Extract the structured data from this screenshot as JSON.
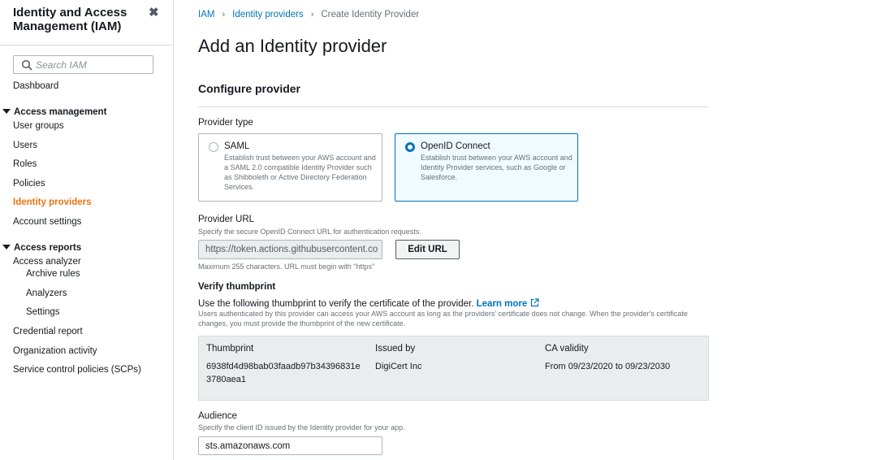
{
  "sidebar": {
    "title": "Identity and Access Management (IAM)",
    "search_placeholder": "Search IAM",
    "dashboard": "Dashboard",
    "access_management": {
      "heading": "Access management",
      "items": [
        "User groups",
        "Users",
        "Roles",
        "Policies",
        "Identity providers",
        "Account settings"
      ]
    },
    "access_reports": {
      "heading": "Access reports",
      "items": [
        "Access analyzer",
        "Archive rules",
        "Analyzers",
        "Settings",
        "Credential report",
        "Organization activity",
        "Service control policies (SCPs)"
      ]
    }
  },
  "breadcrumb": [
    "IAM",
    "Identity providers",
    "Create Identity Provider"
  ],
  "page_title": "Add an Identity provider",
  "configure": {
    "title": "Configure provider",
    "provider_type_label": "Provider type",
    "options": [
      {
        "title": "SAML",
        "description": "Establish trust between your AWS account and a SAML 2.0 compatible Identity Provider such as Shibboleth or Active Directory Federation Services.",
        "selected": false
      },
      {
        "title": "OpenID Connect",
        "description": "Establish trust between your AWS account and Identity Provider services, such as Google or Salesforce.",
        "selected": true
      }
    ],
    "provider_url": {
      "label": "Provider URL",
      "description": "Specify the secure OpenID Connect URL for authentication requests.",
      "value": "https://token.actions.githubusercontent.co",
      "edit_button": "Edit URL",
      "constraint": "Maximum 255 characters. URL must begin with \"https\""
    },
    "thumbprint": {
      "title": "Verify thumbprint",
      "instruction": "Use the following thumbprint to verify the certificate of the provider.",
      "learn_more": "Learn more",
      "description": "Users authenticated by this provider can access your AWS account as long as the providers' certificate does not change. When the provider's certificate changes, you must provide the thumbprint of the new certificate.",
      "headers": [
        "Thumbprint",
        "Issued by",
        "CA validity"
      ],
      "row": {
        "thumbprint_line1": "6938fd4d98bab03faadb97b34396831e",
        "thumbprint_line2": "3780aea1",
        "issued_by": "DigiCert Inc",
        "validity": "From 09/23/2020 to 09/23/2030"
      }
    },
    "audience": {
      "label": "Audience",
      "description": "Specify the client ID issued by the Identity provider for your app.",
      "value": "sts.amazonaws.com"
    }
  },
  "colors": {
    "link": "#0073bb",
    "active_nav": "#ec7211",
    "selected_card_bg": "#f1faff"
  }
}
